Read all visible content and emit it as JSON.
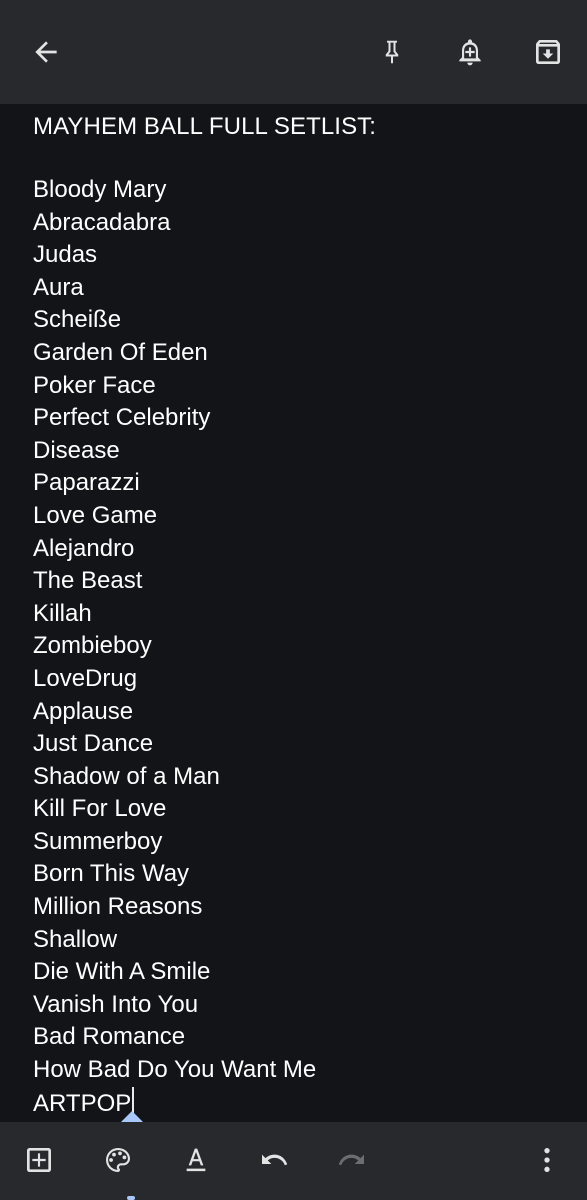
{
  "toolbar": {
    "back_icon": "arrow-back-icon",
    "pin_icon": "pin-icon",
    "reminder_icon": "add-alert-icon",
    "archive_icon": "archive-icon"
  },
  "note": {
    "title": "MAYHEM BALL FULL SETLIST:",
    "songs": [
      "Bloody Mary",
      "Abracadabra",
      "Judas",
      "Aura",
      "Scheiße",
      "Garden Of Eden",
      "Poker Face",
      "Perfect Celebrity",
      "Disease",
      "Paparazzi",
      "Love Game",
      "Alejandro",
      "The Beast",
      "Killah",
      "Zombieboy",
      "LoveDrug",
      "Applause",
      "Just Dance",
      "Shadow of a Man",
      "Kill For Love",
      "Summerboy",
      "Born This Way",
      "Million Reasons",
      "Shallow",
      "Die With A Smile",
      "Vanish Into You",
      "Bad Romance",
      "How Bad Do You Want Me",
      "ARTPOP"
    ]
  },
  "bottom_bar": {
    "add_icon": "add-box-icon",
    "palette_icon": "palette-icon",
    "format_icon": "text-format-icon",
    "undo_icon": "undo-icon",
    "redo_icon": "redo-icon",
    "more_icon": "more-vert-icon"
  },
  "colors": {
    "background": "#121418",
    "bar": "#27292d",
    "text": "#ffffff",
    "icon": "#e3e3e3",
    "icon_disabled": "#6b6d70",
    "accent": "#a8c7fa"
  }
}
